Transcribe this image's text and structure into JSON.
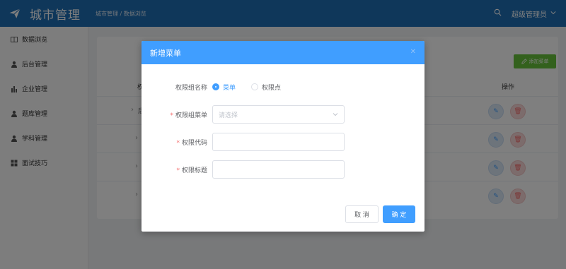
{
  "header": {
    "app_title": "城市管理",
    "breadcrumb": "城市管理 / 数据浏览",
    "user_name": "超级管理员"
  },
  "sidebar": {
    "items": [
      {
        "label": "数据浏览",
        "icon": "book-icon"
      },
      {
        "label": "后台管理",
        "icon": "user-icon"
      },
      {
        "label": "企业管理",
        "icon": "bar-chart-icon"
      },
      {
        "label": "题库管理",
        "icon": "user-icon"
      },
      {
        "label": "学科管理",
        "icon": "user-icon"
      },
      {
        "label": "面试技巧",
        "icon": "grid-icon"
      }
    ]
  },
  "main": {
    "add_button_label": "添加菜单",
    "column_partial": "权",
    "column_operation": "操作",
    "row_partial": "后"
  },
  "dialog": {
    "title": "新增菜单",
    "fields": {
      "type_label": "权限组名称",
      "type_options": [
        "菜单",
        "权限点"
      ],
      "type_selected": "菜单",
      "menu_label": "权限组菜单",
      "menu_placeholder": "请选择",
      "code_label": "权限代码",
      "code_value": "",
      "title_label": "权限标题",
      "title_value": ""
    },
    "cancel_label": "取 消",
    "confirm_label": "确 定"
  },
  "colors": {
    "header_bg": "#1f6fb5",
    "primary": "#409eff",
    "success": "#67c23a",
    "danger": "#f56c6c"
  }
}
